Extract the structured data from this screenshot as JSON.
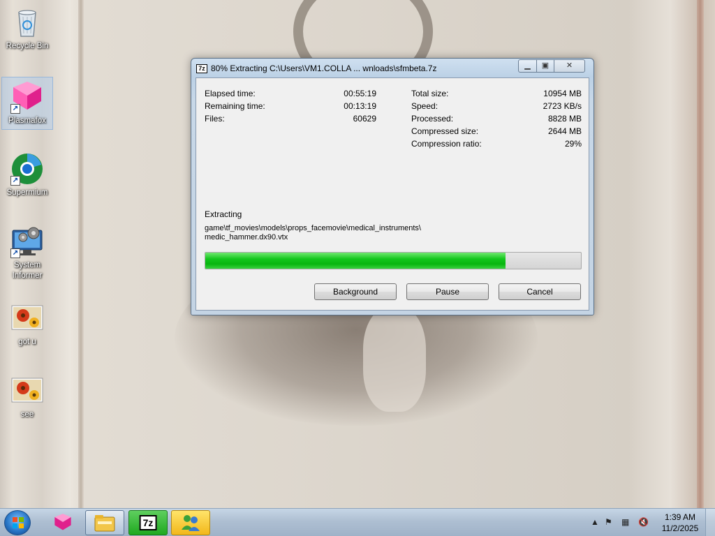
{
  "desktop": {
    "icons": [
      {
        "label": "Recycle Bin"
      },
      {
        "label": "Plasmafox"
      },
      {
        "label": "Supermium"
      },
      {
        "label": "System Informer"
      },
      {
        "label": "got u"
      },
      {
        "label": "see"
      }
    ]
  },
  "dialog": {
    "title": "80% Extracting C:\\Users\\VM1.COLLA ... wnloads\\sfmbeta.7z",
    "app_icon": "7z",
    "caption_buttons": {
      "minimize": "minimize-icon",
      "maximize": "maximize-icon",
      "close": "close-icon"
    },
    "stats_left": [
      {
        "label": "Elapsed time:",
        "value": "00:55:19"
      },
      {
        "label": "Remaining time:",
        "value": "00:13:19"
      },
      {
        "label": "Files:",
        "value": "60629"
      }
    ],
    "stats_right": [
      {
        "label": "Total size:",
        "value": "10954 MB"
      },
      {
        "label": "Speed:",
        "value": "2723 KB/s"
      },
      {
        "label": "Processed:",
        "value": "8828 MB"
      },
      {
        "label": "Compressed size:",
        "value": "2644 MB"
      },
      {
        "label": "Compression ratio:",
        "value": "29%"
      }
    ],
    "status_label": "Extracting",
    "current_file_line1": "game\\tf_movies\\models\\props_facemovie\\medical_instruments\\",
    "current_file_line2": "medic_hammer.dx90.vtx",
    "progress_percent": 80,
    "progress_color": "#13c61c",
    "buttons": {
      "background": "Background",
      "pause": "Pause",
      "cancel": "Cancel"
    }
  },
  "taskbar": {
    "apps": [
      {
        "name": "plasmafox-icon"
      },
      {
        "name": "file-explorer-icon"
      },
      {
        "name": "sevenzip-icon",
        "text": "7z"
      },
      {
        "name": "messenger-icon"
      }
    ],
    "clock": {
      "time": "1:39 AM",
      "date": "11/2/2025"
    }
  }
}
